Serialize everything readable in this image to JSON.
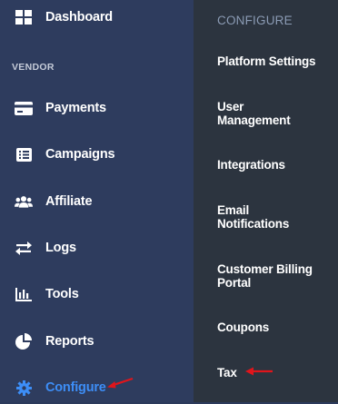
{
  "sidebar": {
    "top_item": {
      "label": "Dashboard",
      "icon": "dashboard-icon"
    },
    "section_label": "VENDOR",
    "items": [
      {
        "label": "Payments",
        "icon": "credit-card-icon"
      },
      {
        "label": "Campaigns",
        "icon": "list-icon"
      },
      {
        "label": "Affiliate",
        "icon": "users-icon"
      },
      {
        "label": "Logs",
        "icon": "exchange-arrows-icon"
      },
      {
        "label": "Tools",
        "icon": "bar-chart-icon"
      },
      {
        "label": "Reports",
        "icon": "pie-chart-icon"
      },
      {
        "label": "Configure",
        "icon": "gear-icon",
        "active": true
      }
    ]
  },
  "flyout": {
    "title": "CONFIGURE",
    "items": [
      {
        "label_lines": [
          "Platform Settings"
        ]
      },
      {
        "label_lines": [
          "User",
          "Management"
        ]
      },
      {
        "label_lines": [
          "Integrations"
        ]
      },
      {
        "label_lines": [
          "Email",
          "Notifications"
        ]
      },
      {
        "label_lines": [
          "Customer Billing",
          "Portal"
        ]
      },
      {
        "label_lines": [
          "Coupons"
        ]
      },
      {
        "label_lines": [
          "Tax"
        ]
      }
    ]
  },
  "colors": {
    "sidebar_bg": "#2e3c5e",
    "flyout_bg": "#2c343f",
    "active_text": "#3d8ef7",
    "annotation_arrow": "#e0151b"
  }
}
